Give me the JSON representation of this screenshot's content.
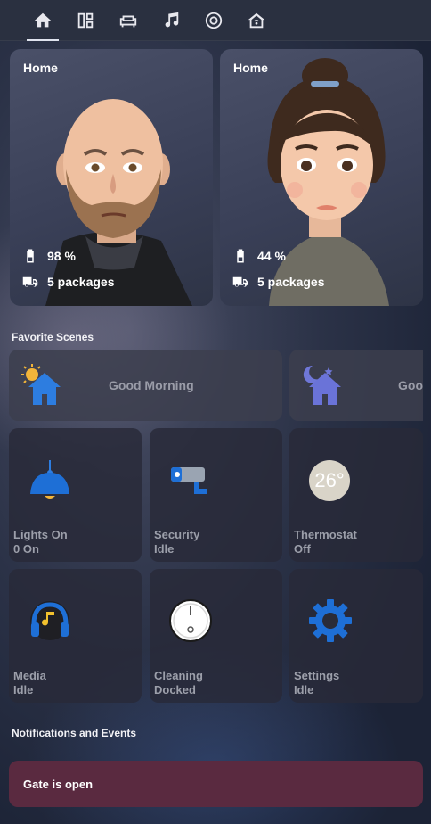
{
  "nav": {
    "tabs": [
      {
        "icon": "home-icon",
        "active": true
      },
      {
        "icon": "dashboard-icon",
        "active": false
      },
      {
        "icon": "sofa-icon",
        "active": false
      },
      {
        "icon": "music-icon",
        "active": false
      },
      {
        "icon": "robot-vacuum-icon",
        "active": false
      },
      {
        "icon": "house-wifi-icon",
        "active": false
      }
    ]
  },
  "people": [
    {
      "status": "Home",
      "battery": "98 %",
      "packages": "5 packages"
    },
    {
      "status": "Home",
      "battery": "44 %",
      "packages": "5 packages"
    }
  ],
  "scenes": {
    "title": "Favorite Scenes",
    "items": [
      {
        "label": "Good Morning",
        "icon": "sun-house-icon"
      },
      {
        "label": "Goo",
        "icon": "moon-house-icon"
      }
    ]
  },
  "tiles": [
    {
      "name": "Lights On",
      "state": "0 On",
      "icon": "ceiling-lamp-icon"
    },
    {
      "name": "Security",
      "state": "Idle",
      "icon": "security-camera-icon"
    },
    {
      "name": "Thermostat",
      "state": "Off",
      "icon": "thermostat-icon",
      "value": "26°"
    },
    {
      "name": "Media",
      "state": "Idle",
      "icon": "headphones-icon"
    },
    {
      "name": "Cleaning",
      "state": "Docked",
      "icon": "robot-vacuum-icon"
    },
    {
      "name": "Settings",
      "state": "Idle",
      "icon": "gear-icon"
    }
  ],
  "notifications": {
    "title": "Notifications and Events",
    "items": [
      {
        "text": "Gate is open"
      }
    ]
  },
  "colors": {
    "accent_blue": "#1e6fd6",
    "notification_bg": "#5a2a40"
  }
}
